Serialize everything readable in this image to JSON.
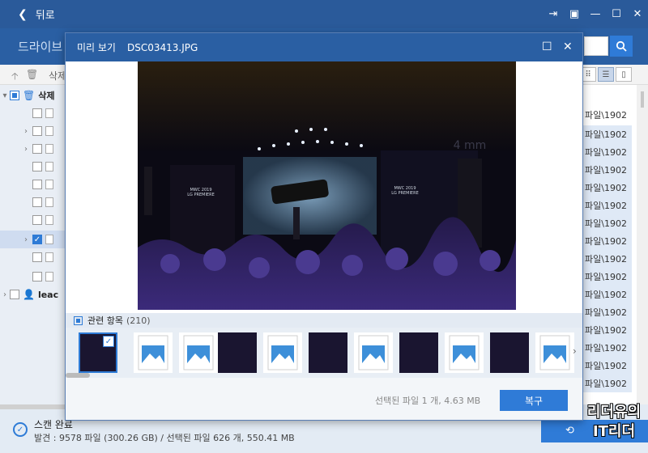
{
  "titlebar": {
    "back_label": "뒤로"
  },
  "header": {
    "drive_label": "드라이브"
  },
  "toolbar": {
    "crumb": "삭제"
  },
  "tree": {
    "rows": [
      {
        "label": "삭제"
      },
      {
        "label": ""
      },
      {
        "label": ""
      },
      {
        "label": ""
      },
      {
        "label": ""
      },
      {
        "label": ""
      },
      {
        "label": ""
      },
      {
        "label": ""
      },
      {
        "label": ""
      },
      {
        "label": ""
      },
      {
        "label": ""
      },
      {
        "label": "leac"
      }
    ]
  },
  "right_list": {
    "rows": [
      "파일\\1902",
      "파일\\1902",
      "파일\\1902",
      "파일\\1902",
      "파일\\1902",
      "파일\\1902",
      "파일\\1902",
      "파일\\1902",
      "파일\\1902",
      "파일\\1902",
      "파일\\1902",
      "파일\\1902",
      "파일\\1902",
      "파일\\1902",
      "파일\\1902",
      "파일\\1902"
    ]
  },
  "modal": {
    "title": "미리 보기",
    "filename": "DSC03413.JPG",
    "related_label": "관련 항목",
    "related_count": "(210)",
    "selected_info": "선택된 파일 1 개, 4.63 MB",
    "restore_label": "복구",
    "stage_text": {
      "logo_left": "MWC 2019\nLG PREMIERE",
      "logo_right": "MWC 2019\nLG PREMIERE",
      "corner": "4 mm"
    }
  },
  "status": {
    "line1": "스캔 완료",
    "line2": "발견 : 9578 파일 (300.26 GB) / 선택된 파일 626 개, 550.41 MB"
  },
  "watermark": {
    "line1": "리더유의",
    "line2": "IT리더"
  },
  "colors": {
    "accent": "#2f7bd7",
    "header": "#2a5fa3"
  }
}
